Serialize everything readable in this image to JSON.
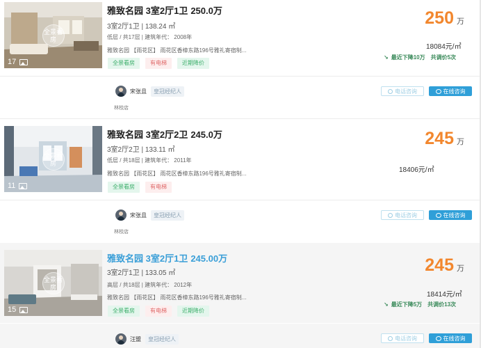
{
  "listings": [
    {
      "photo_count": "17",
      "pano_label": "全景看房",
      "title": "雅致名园 3室2厅1卫",
      "price_text": "250.0万",
      "layout_area": "3室2厅1卫 | 138.24 ㎡",
      "floor_year": "低层 / 共17层 | 建筑年代： 2008年",
      "address": "雅致名园 【雨花区】 雨花区香樟东路196号雅礼寄宿制...",
      "tags": [
        "全景看房",
        "有电梯",
        "近期降价"
      ],
      "total_price": "250",
      "price_unit": "万",
      "unit_price": "18084元/㎡",
      "price_drop": "最近下降10万",
      "price_adjust": "共调价5次",
      "agent_name": "宋张且",
      "agent_badge": "皇冠经纪人",
      "store": "林校店",
      "phone_btn": "电话咨询",
      "chat_btn": "在线咨询"
    },
    {
      "photo_count": "11",
      "pano_label": "全景看房",
      "title": "雅致名园 3室2厅2卫",
      "price_text": "245.0万",
      "layout_area": "3室2厅2卫 | 133.11 ㎡",
      "floor_year": "低层 / 共18层 | 建筑年代： 2011年",
      "address": "雅致名园 【雨花区】 雨花区香樟东路196号雅礼寄宿制...",
      "tags": [
        "全景看房",
        "有电梯"
      ],
      "total_price": "245",
      "price_unit": "万",
      "unit_price": "18406元/㎡",
      "agent_name": "宋张且",
      "agent_badge": "皇冠经纪人",
      "store": "林校店",
      "phone_btn": "电话咨询",
      "chat_btn": "在线咨询"
    },
    {
      "photo_count": "15",
      "pano_label": "全景看房",
      "title": "雅致名园 3室2厅1卫",
      "price_text": "245.00万",
      "layout_area": "3室2厅1卫 | 133.05 ㎡",
      "floor_year": "高层 / 共18层 | 建筑年代： 2012年",
      "address": "雅致名园 【雨花区】 雨花区香樟东路196号雅礼寄宿制...",
      "tags": [
        "全景看房",
        "有电梯",
        "近期降价"
      ],
      "total_price": "245",
      "price_unit": "万",
      "unit_price": "18414元/㎡",
      "price_drop": "最近下降5万",
      "price_adjust": "共调价13次",
      "agent_name": "汪盟",
      "agent_badge": "皇冠经纪人",
      "phone_btn": "电话咨询",
      "chat_btn": "在线咨询"
    }
  ],
  "colors": {
    "price": "#f2872e",
    "link": "#3a9fd8",
    "tag_green": "#3cae6a",
    "tag_red": "#e06b6b",
    "chat_button": "#2f9fd8"
  }
}
